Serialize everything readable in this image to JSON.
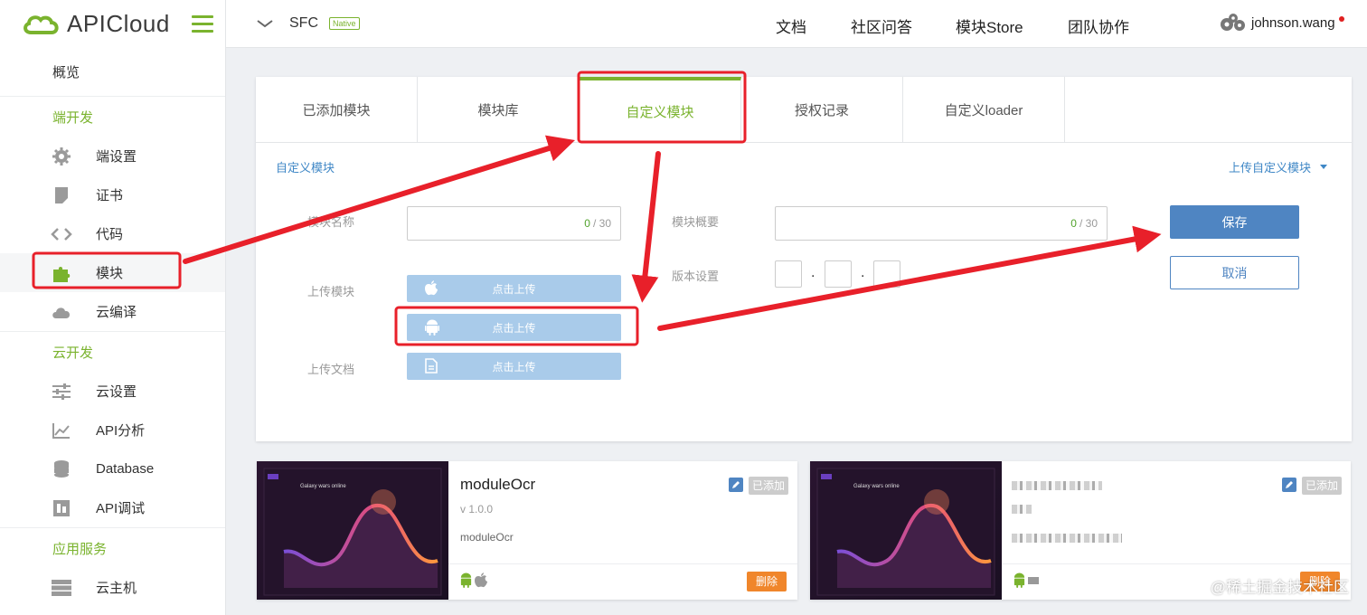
{
  "app": {
    "logo_text": "APICloud"
  },
  "topbar": {
    "project_name": "SFC",
    "project_badge": "Native",
    "nav": [
      "文档",
      "社区问答",
      "模块Store",
      "团队协作"
    ],
    "user": "johnson.wang"
  },
  "sidebar": {
    "overview": "概览",
    "groups": [
      {
        "title": "端开发",
        "items": [
          {
            "label": "端设置",
            "icon": "gear-icon"
          },
          {
            "label": "证书",
            "icon": "certificate-icon"
          },
          {
            "label": "代码",
            "icon": "code-icon"
          },
          {
            "label": "模块",
            "icon": "puzzle-icon",
            "active": true
          },
          {
            "label": "云编译",
            "icon": "cloud-icon"
          }
        ]
      },
      {
        "title": "云开发",
        "items": [
          {
            "label": "云设置",
            "icon": "sliders-icon"
          },
          {
            "label": "API分析",
            "icon": "chart-icon"
          },
          {
            "label": "Database",
            "icon": "database-icon"
          },
          {
            "label": "API调试",
            "icon": "debug-icon"
          }
        ]
      },
      {
        "title": "应用服务",
        "items": [
          {
            "label": "云主机",
            "icon": "server-icon"
          }
        ]
      }
    ]
  },
  "tabs": [
    "已添加模块",
    "模块库",
    "自定义模块",
    "授权记录",
    "自定义loader"
  ],
  "active_tab": "自定义模块",
  "form": {
    "section_title": "自定义模块",
    "upload_custom": "上传自定义模块",
    "name_label": "模块名称",
    "name_count": "0",
    "name_max": "/ 30",
    "summary_label": "模块概要",
    "summary_count": "0",
    "summary_max": "/ 30",
    "upload_module_label": "上传模块",
    "upload_doc_label": "上传文档",
    "version_label": "版本设置",
    "upload_ios": "点击上传",
    "upload_android": "点击上传",
    "upload_doc": "点击上传",
    "save": "保存",
    "cancel": "取消"
  },
  "cards": [
    {
      "name": "moduleOcr",
      "version": "v 1.0.0",
      "desc": "moduleOcr",
      "added": "已添加",
      "delete": "删除",
      "thumb_title": "Galaxy wars online"
    },
    {
      "name": "",
      "version": "",
      "desc": "",
      "added": "已添加",
      "delete": "删除",
      "thumb_title": "Galaxy wars online"
    }
  ],
  "watermark": "@稀土掘金技术社区",
  "colors": {
    "accent": "#7ab32e",
    "link": "#3f87c6",
    "primary": "#4f85c2",
    "danger": "#f0862b",
    "annotation": "#e8202a"
  }
}
